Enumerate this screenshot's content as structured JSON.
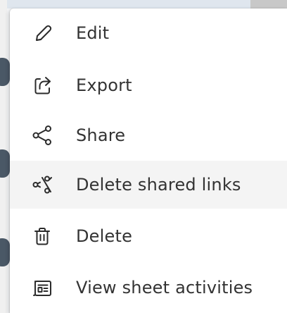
{
  "menu": {
    "items": [
      {
        "label": "Edit",
        "icon": "pencil-icon"
      },
      {
        "label": "Export",
        "icon": "export-icon"
      },
      {
        "label": "Share",
        "icon": "share-icon"
      },
      {
        "label": "Delete shared links",
        "icon": "unlink-share-icon",
        "highlighted": true
      },
      {
        "label": "Delete",
        "icon": "trash-icon"
      },
      {
        "label": "View sheet activities",
        "icon": "activity-log-icon"
      }
    ]
  },
  "colors": {
    "menu_background": "#ffffff",
    "highlight_background": "#f4f4f4",
    "text": "#333333",
    "icon": "#2b2b2b"
  }
}
